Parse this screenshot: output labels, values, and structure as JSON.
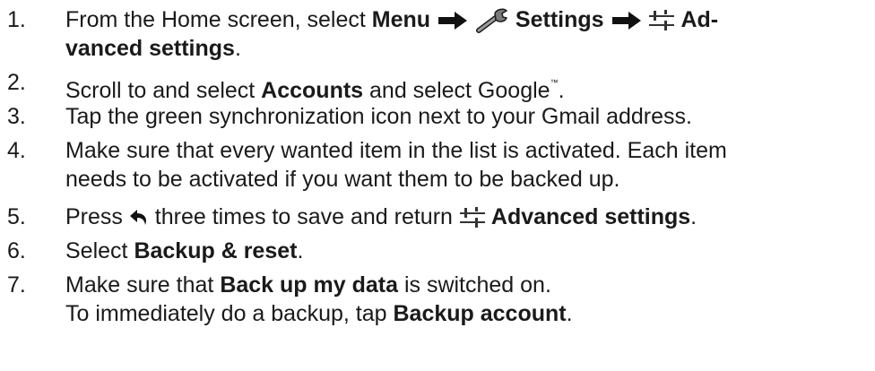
{
  "steps": [
    {
      "number": "1.",
      "line1": {
        "a": "From the Home screen, select ",
        "b": "Menu",
        "c": " Settings",
        "d": " Ad-"
      },
      "line2": {
        "a": "vanced settings",
        "b": "."
      }
    },
    {
      "number": "2.",
      "a": "Scroll to and select ",
      "b": "Accounts",
      "c": " and select Google",
      "tm": "™",
      "d": "."
    },
    {
      "number": "3.",
      "text": "Tap the green synchronization icon next to your Gmail address."
    },
    {
      "number": "4.",
      "line1": "Make sure that every wanted item in the list is activated. Each item",
      "line2": "needs to be activated if you want them to be backed up."
    },
    {
      "number": "5.",
      "a": "Press ",
      "b": " three times to save and return ",
      "c": " Advanced settings",
      "d": "."
    },
    {
      "number": "6.",
      "a": "Select ",
      "b": "Backup & reset",
      "c": "."
    },
    {
      "number": "7.",
      "line1": {
        "a": "Make sure that ",
        "b": "Back up my data",
        "c": " is switched on."
      },
      "line2": {
        "a": "To immediately do a backup, tap ",
        "b": "Backup account",
        "c": "."
      }
    }
  ],
  "icons": {
    "arrow": "arrow-right-icon",
    "settings": "wrench-icon",
    "advanced": "sliders-icon",
    "back": "back-arrow-icon"
  }
}
